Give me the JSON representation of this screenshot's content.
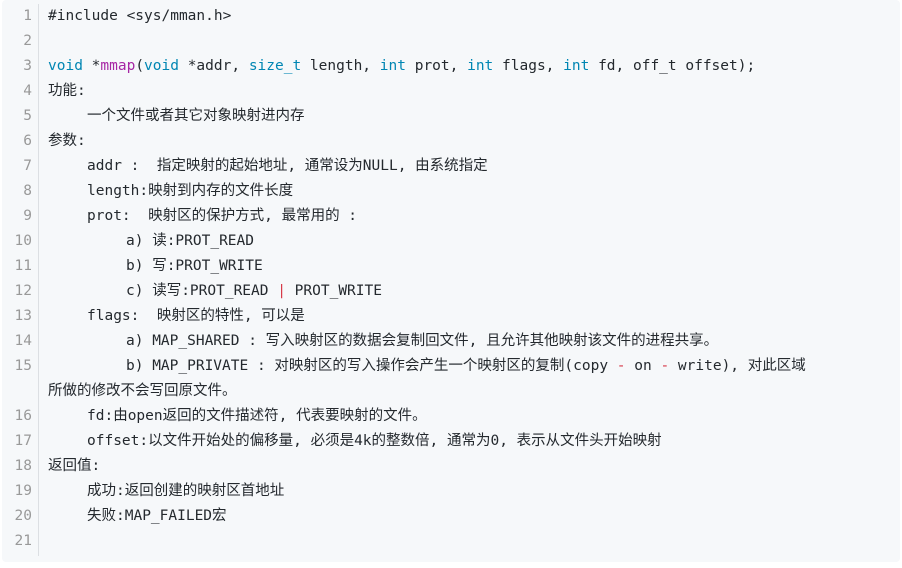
{
  "line_numbers": [
    "1",
    "2",
    "3",
    "4",
    "5",
    "6",
    "7",
    "8",
    "9",
    "10",
    "11",
    "12",
    "13",
    "14",
    "15",
    "16",
    "17",
    "18",
    "19",
    "20",
    "21"
  ],
  "code": {
    "l1": "#include <sys/mman.h>",
    "l3": {
      "t1": "void",
      "t2": " *",
      "t3": "mmap",
      "t4": "(",
      "t5": "void",
      "t6": " *addr, ",
      "t7": "size_t",
      "t8": " length, ",
      "t9": "int",
      "t10": " prot, ",
      "t11": "int",
      "t12": " flags, ",
      "t13": "int",
      "t14": " fd, off_t offset);"
    },
    "l4": "功能:",
    "l5": "一个文件或者其它对象映射进内存",
    "l6": "参数:",
    "l7": "addr :  指定映射的起始地址, 通常设为NULL, 由系统指定",
    "l8": "length:映射到内存的文件长度",
    "l9": "prot:  映射区的保护方式, 最常用的 :",
    "l10": "a) 读:PROT_READ",
    "l11": "b) 写:PROT_WRITE",
    "l12": {
      "a": "c) 读写:PROT_READ ",
      "b": "|",
      "c": " PROT_WRITE"
    },
    "l13": "flags:  映射区的特性, 可以是",
    "l14": "a) MAP_SHARED : 写入映射区的数据会复制回文件, 且允许其他映射该文件的进程共享。",
    "l15": {
      "a": "b) MAP_PRIVATE : 对映射区的写入操作会产生一个映射区的复制(copy ",
      "b": "-",
      "c": " on ",
      "d": "-",
      "e": " write), 对此区域",
      "f": "所做的修改不会写回原文件。"
    },
    "l16": "fd:由open返回的文件描述符, 代表要映射的文件。",
    "l17": "offset:以文件开始处的偏移量, 必须是4k的整数倍, 通常为0, 表示从文件头开始映射",
    "l18": "返回值:",
    "l19": "成功:返回创建的映射区首地址",
    "l20": "失败:MAP_FAILED宏"
  },
  "colors": {
    "keyword": "#0086b3",
    "function": "#a626a4",
    "operator": "#d73a49",
    "line_number": "#999999",
    "background": "#f6f8fa"
  }
}
